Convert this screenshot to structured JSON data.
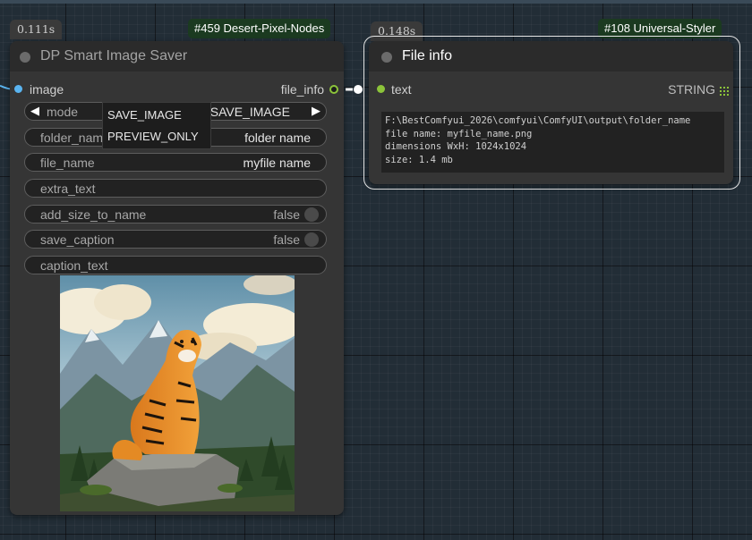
{
  "left_node": {
    "timing": "0.111s",
    "badge": "#459 Desert-Pixel-Nodes",
    "title": "DP Smart Image Saver",
    "input_label": "image",
    "output_label": "file_info",
    "widgets": {
      "mode": {
        "label": "mode",
        "value": "SAVE_IMAGE"
      },
      "folder_name": {
        "label": "folder_nam",
        "value": "folder name"
      },
      "file_name": {
        "label": "file_name",
        "value": "myfile name"
      },
      "extra_text": {
        "label": "extra_text"
      },
      "add_size_to_name": {
        "label": "add_size_to_name",
        "value": "false"
      },
      "save_caption": {
        "label": "save_caption",
        "value": "false"
      },
      "caption_text": {
        "label": "caption_text"
      }
    },
    "mode_menu": [
      "SAVE_IMAGE",
      "PREVIEW_ONLY"
    ],
    "preview_icon": "tiger-on-rock-mountain-image"
  },
  "right_node": {
    "timing": "0.148s",
    "badge": "#108 Universal-Styler",
    "title": "File info",
    "input_label": "text",
    "type_label": "STRING",
    "output_lines": [
      "F:\\BestComfyui_2026\\comfyui\\ComfyUI\\output\\folder_name",
      "file name: myfile_name.png",
      "dimensions WxH: 1024x1024",
      "size: 1.4 mb"
    ]
  },
  "colors": {
    "canvas": "#222d36",
    "badge_bg": "#1b3a20",
    "image_socket": "#5ab4f0",
    "string_socket": "#8cc43a",
    "selected_outline": "#e6e6e6"
  }
}
